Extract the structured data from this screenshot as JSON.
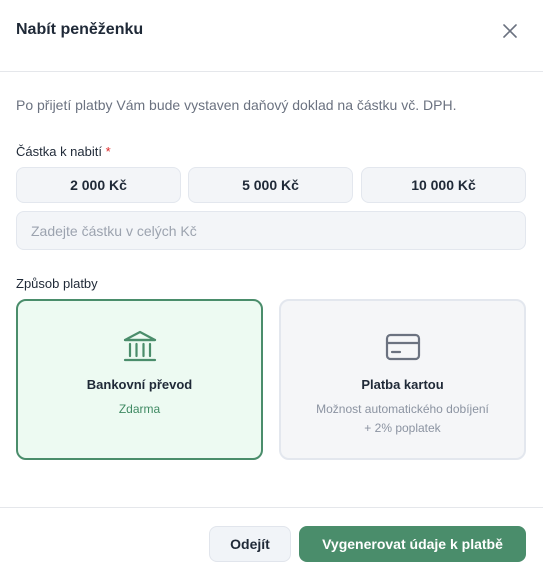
{
  "dialog": {
    "title": "Nabít peněženku",
    "close_icon": "close-icon"
  },
  "info_text": "Po přijetí platby Vám bude vystaven daňový doklad na částku vč. DPH.",
  "amount": {
    "label": "Částka k nabití",
    "required_mark": "*",
    "presets": [
      "2 000 Kč",
      "5 000 Kč",
      "10 000 Kč"
    ],
    "input_value": "",
    "input_placeholder": "Zadejte částku v celých Kč"
  },
  "payment": {
    "label": "Způsob platby",
    "selected": "bank-transfer",
    "methods": [
      {
        "id": "bank-transfer",
        "icon": "bank-icon",
        "title": "Bankovní převod",
        "subtitle_lines": [
          "Zdarma"
        ]
      },
      {
        "id": "card",
        "icon": "credit-card-icon",
        "title": "Platba kartou",
        "subtitle_lines": [
          "Možnost automatického dobíjení",
          "+ 2% poplatek"
        ]
      }
    ]
  },
  "footer": {
    "cancel_label": "Odejít",
    "submit_label": "Vygenerovat údaje k platbě"
  },
  "colors": {
    "accent": "#4a8d6b",
    "selected_bg": "#edfaf2",
    "required": "#dc2626"
  }
}
